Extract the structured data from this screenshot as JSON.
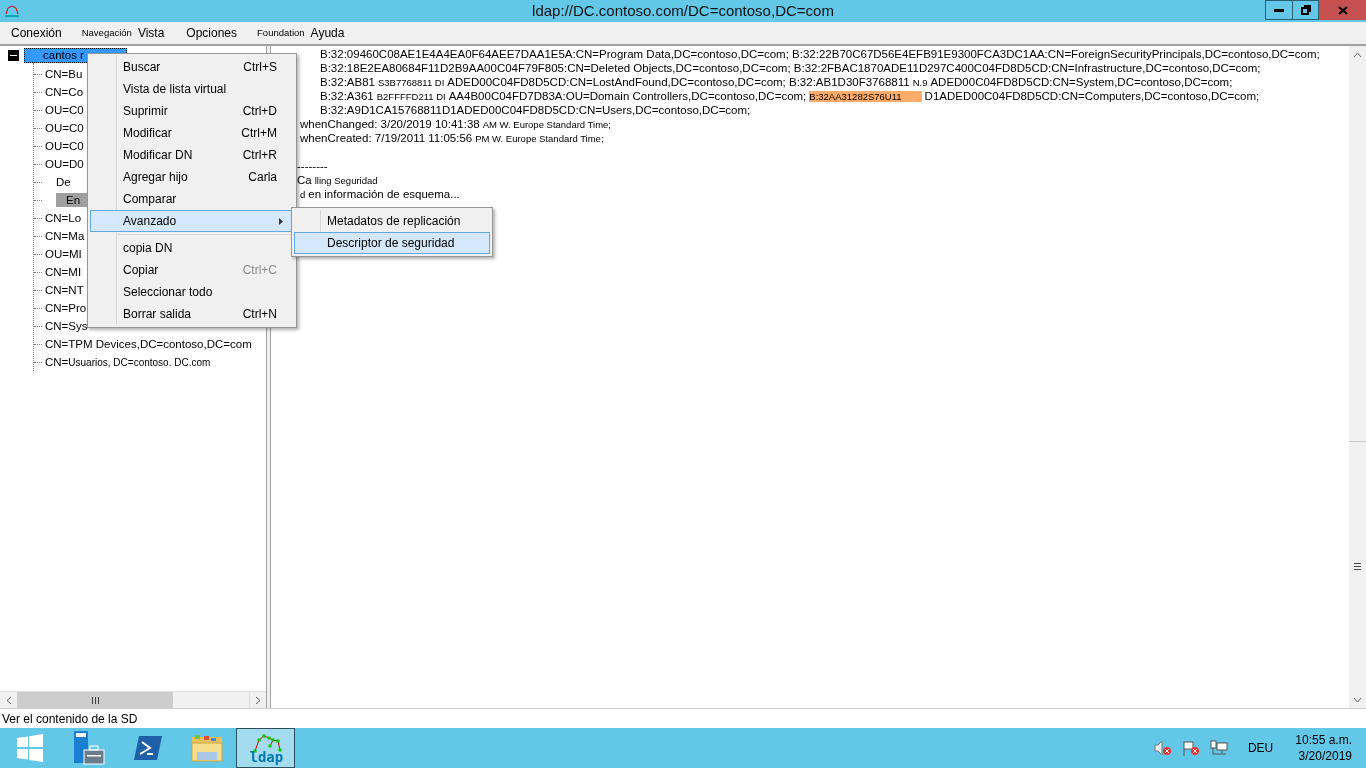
{
  "window": {
    "title": "ldap://DC.contoso.com/DC=contoso,DC=com"
  },
  "menu_bar": [
    {
      "label": "Conexión",
      "kind": "normal"
    },
    {
      "label": "Navegación",
      "kind": "small"
    },
    {
      "label": "Vista",
      "kind": "normal"
    },
    {
      "label": "Opciones",
      "kind": "normal"
    },
    {
      "label": "Foundation",
      "kind": "small"
    },
    {
      "label": "Ayuda",
      "kind": "normal"
    }
  ],
  "tree": {
    "root": {
      "label": "cantos r",
      "selected": true,
      "expanded": true
    },
    "children": [
      {
        "label": "CN=Bu",
        "kind": "plain",
        "selected": false
      },
      {
        "label": "CN=Co",
        "kind": "plain",
        "selected": false
      },
      {
        "label": "OU=C0",
        "kind": "plain",
        "selected": false
      },
      {
        "label": "OU=C0",
        "kind": "plain",
        "selected": false
      },
      {
        "label": "OU=C0",
        "kind": "plain",
        "selected": false
      },
      {
        "label": "OU=D0",
        "kind": "plain",
        "selected": false
      },
      {
        "label": "De",
        "kind": "inset",
        "selected": false
      },
      {
        "label": "En",
        "kind": "inset",
        "selected": true
      },
      {
        "label": "CN=Lo",
        "kind": "plain",
        "selected": false
      },
      {
        "label": "CN=Ma",
        "kind": "plain",
        "selected": false
      },
      {
        "label": "OU=MI",
        "kind": "plain",
        "selected": false
      },
      {
        "label": "CN=MI",
        "kind": "plain",
        "selected": false
      },
      {
        "label": "CN=NT",
        "kind": "plain",
        "selected": false
      },
      {
        "label": "CN=Pro",
        "kind": "plain",
        "selected": false
      },
      {
        "label": "CN=Sys",
        "kind": "plain",
        "selected": false
      },
      {
        "label": "CN=TPM Devices,DC=contoso,DC=com",
        "kind": "plain",
        "selected": false
      },
      {
        "label": "CN=",
        "note": "Usuarios, DC=contoso. DC.com",
        "kind": "plain",
        "selected": false
      }
    ]
  },
  "output": {
    "lines": [
      {
        "kind": "value",
        "segments": [
          {
            "text": "B:32:09460C08AE1E4A4EA0F64AEE7DAA1E5A:CN=Program Data,DC=contoso,DC=com; B:32:22B70C67D56E4EFB91E9300FCA3DC1AA:CN=ForeignSecurityPrincipals,DC=contoso,DC=com;",
            "kind": "normal"
          }
        ]
      },
      {
        "kind": "value",
        "segments": [
          {
            "text": "B:32:18E2EA80684F11D2B9AA00C04F79F805:CN=Deleted Objects,DC=contoso,DC=com; B:32:2FBAC1870ADE11D297C400C04FD8D5CD:CN=Infrastructure,DC=contoso,DC=com;",
            "kind": "normal"
          }
        ]
      },
      {
        "kind": "value",
        "segments": [
          {
            "text": "B:32:AB81",
            "kind": "normal"
          },
          {
            "text": "S3B7768811 DI",
            "kind": "small"
          },
          {
            "text": "ADED00C04FD8D5CD:CN=LostAndFound,DC=contoso,DC=com; B:32:AB1D30F3768811",
            "kind": "normal"
          },
          {
            "text": "N.9",
            "kind": "small"
          },
          {
            "text": "ADED00C04FD8D5CD:CN=System,DC=contoso,DC=com;",
            "kind": "normal"
          }
        ]
      },
      {
        "kind": "value",
        "segments": [
          {
            "text": "B:32:A361",
            "kind": "normal"
          },
          {
            "text": "B2FFFFD211 DI",
            "kind": "small"
          },
          {
            "text": "AA4B00C04FD7D83A:OU=Domain Controllers,DC=contoso,DC=com;",
            "kind": "normal"
          },
          {
            "text": "B:32AA31282S76U11",
            "kind": "highlight"
          },
          {
            "text": "D1ADED00C04FD8D5CD:CN=Computers,DC=contoso,DC=com;",
            "kind": "normal"
          }
        ]
      },
      {
        "kind": "value",
        "segments": [
          {
            "text": "B:32:A9D1CA15768811D1ADED00C04FD8D5CD:CN=Users,DC=contoso,DC=com;",
            "kind": "normal"
          }
        ]
      },
      {
        "kind": "attribute",
        "segments": [
          {
            "text": "whenChanged: 3/20/2019 10:41:38",
            "kind": "normal"
          },
          {
            "text": "AM W. Europe Standard Time;",
            "kind": "small"
          }
        ]
      },
      {
        "kind": "attribute",
        "segments": [
          {
            "text": "whenCreated: 7/19/2011 11:05:56",
            "kind": "normal"
          },
          {
            "text": "PM W. Europe Standard Time;",
            "kind": "small"
          }
        ]
      },
      {
        "kind": "divider",
        "segments": [
          {
            "text": "--------",
            "kind": "normal"
          }
        ]
      },
      {
        "kind": "log",
        "segments": [
          {
            "text": "Ca",
            "kind": "normal"
          },
          {
            "text": "lling Seguridad",
            "kind": "small"
          }
        ]
      },
      {
        "kind": "log",
        "segments": [
          {
            "text": "d",
            "kind": "small"
          },
          {
            "text": "en información de esquema...",
            "kind": "normal"
          }
        ]
      }
    ]
  },
  "context_menu": {
    "items": [
      {
        "kind": "command",
        "label": "Buscar",
        "shortcut": "Ctrl+S",
        "shortcut_disabled": false,
        "selected": false
      },
      {
        "kind": "command",
        "label": "Vista de lista virtual",
        "selected": false
      },
      {
        "kind": "command",
        "label": "Suprimir",
        "shortcut": "Ctrl+D",
        "shortcut_disabled": false,
        "selected": false
      },
      {
        "kind": "command",
        "label": "Modificar",
        "shortcut": "Ctrl+M",
        "shortcut_disabled": false,
        "selected": false
      },
      {
        "kind": "command",
        "label": "Modificar DN",
        "shortcut": "Ctrl+R",
        "shortcut_disabled": false,
        "selected": false
      },
      {
        "kind": "command",
        "label": "Agregar hijo",
        "shortcut": "Carla",
        "shortcut_disabled": false,
        "selected": false
      },
      {
        "kind": "command",
        "label": "Comparar",
        "selected": false
      },
      {
        "kind": "submenu",
        "label": "Avanzado",
        "selected": true
      },
      {
        "kind": "separator"
      },
      {
        "kind": "command",
        "label": "copia DN",
        "selected": false
      },
      {
        "kind": "command",
        "label": "Copiar",
        "shortcut": "Ctrl+C",
        "shortcut_disabled": true,
        "selected": false
      },
      {
        "kind": "command",
        "label": "Seleccionar todo",
        "selected": false
      },
      {
        "kind": "command",
        "label": "Borrar salida",
        "shortcut": "Ctrl+N",
        "shortcut_disabled": false,
        "selected": false
      }
    ]
  },
  "submenu": {
    "items": [
      {
        "label": "Metadatos de replicación",
        "selected": false
      },
      {
        "label": "Descriptor de seguridad",
        "selected": true
      }
    ]
  },
  "status_bar": "Ver el contenido de la SD",
  "taskbar": {
    "apps": [
      {
        "kind": "start",
        "active": false
      },
      {
        "kind": "server",
        "active": false
      },
      {
        "kind": "shell",
        "active": false
      },
      {
        "kind": "folder",
        "active": false
      },
      {
        "kind": "ldp",
        "active": true,
        "label": "ldap"
      }
    ],
    "tray": {
      "language": "DEU",
      "time": "10:55 a.m.",
      "date": "3/20/2019"
    }
  }
}
